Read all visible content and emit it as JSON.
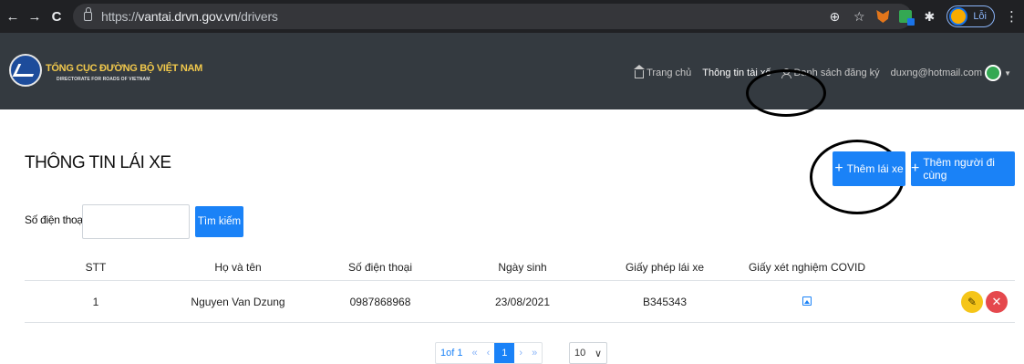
{
  "browser": {
    "url_host": "vantai.drvn.gov.vn",
    "url_prefix": "https://",
    "url_path": "/drivers",
    "profile_label": "Lỗi",
    "nav": {
      "back": "←",
      "forward": "→",
      "reload": "C"
    },
    "icons": {
      "zoom": "⊕",
      "star": "☆",
      "puzzle": "✱",
      "menu": "⋮"
    }
  },
  "header": {
    "org_name": "TỔNG CỤC ĐƯỜNG BỘ VIỆT NAM",
    "org_subtitle": "DIRECTORATE FOR ROADS OF VIETNAM",
    "nav": {
      "home": "Trang chủ",
      "driver_info": "Thông tin tài xế",
      "registrations": "Danh sách đăng ký",
      "user_email": "duxng@hotmail.com"
    },
    "caret": "▼"
  },
  "main": {
    "title": "THÔNG TIN LÁI XE",
    "add_driver": "Thêm lái xe",
    "add_companion": "Thêm người đi cùng",
    "plus": "+",
    "search_label": "Số điện thoại:",
    "search_value": "",
    "search_button": "Tìm kiếm"
  },
  "table": {
    "headers": [
      "STT",
      "Họ và tên",
      "Số điện thoại",
      "Ngày sinh",
      "Giấy phép lái xe",
      "Giấy xét nghiệm COVID"
    ],
    "rows": [
      {
        "stt": "1",
        "name": "Nguyen Van Dzung",
        "phone": "0987868968",
        "dob": "23/08/2021",
        "license": "B345343"
      }
    ],
    "edit_glyph": "✎",
    "delete_glyph": "✕"
  },
  "pagination": {
    "info": "1of 1",
    "first": "«",
    "prev": "‹",
    "current": "1",
    "next": "›",
    "last": "»",
    "page_size": "10",
    "select_caret": "∨"
  },
  "colors": {
    "primary": "#1a82f7",
    "header_bg": "#343a40",
    "org_name": "#f2c94c",
    "edit": "#f5c518",
    "delete": "#e5484d"
  }
}
